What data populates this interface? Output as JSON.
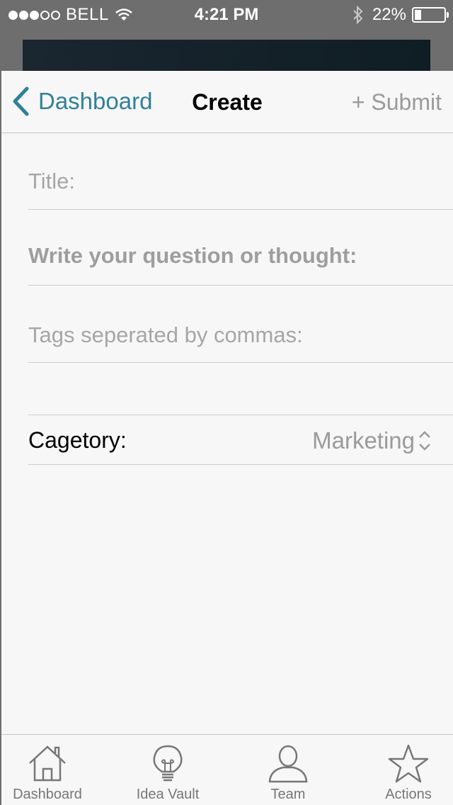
{
  "status_bar": {
    "carrier": "BELL",
    "time": "4:21 PM",
    "battery_percent": "22%",
    "signal_bars_filled": 3,
    "signal_bars_total": 5,
    "battery_level": 0.22
  },
  "nav": {
    "back_label": "Dashboard",
    "title": "Create",
    "submit_label": "+ Submit"
  },
  "form": {
    "title_placeholder": "Title:",
    "question_placeholder": "Write your question or thought:",
    "tags_placeholder": "Tags seperated by commas:",
    "category_label": "Cagetory:",
    "category_value": "Marketing"
  },
  "tabbar": {
    "items": [
      {
        "label": "Dashboard",
        "icon": "house-icon"
      },
      {
        "label": "Idea Vault",
        "icon": "lightbulb-icon"
      },
      {
        "label": "Team",
        "icon": "person-icon"
      },
      {
        "label": "Actions",
        "icon": "star-icon"
      }
    ]
  },
  "colors": {
    "accent": "#2f8197",
    "muted": "#9a9a9a",
    "background": "#f7f7f7"
  }
}
